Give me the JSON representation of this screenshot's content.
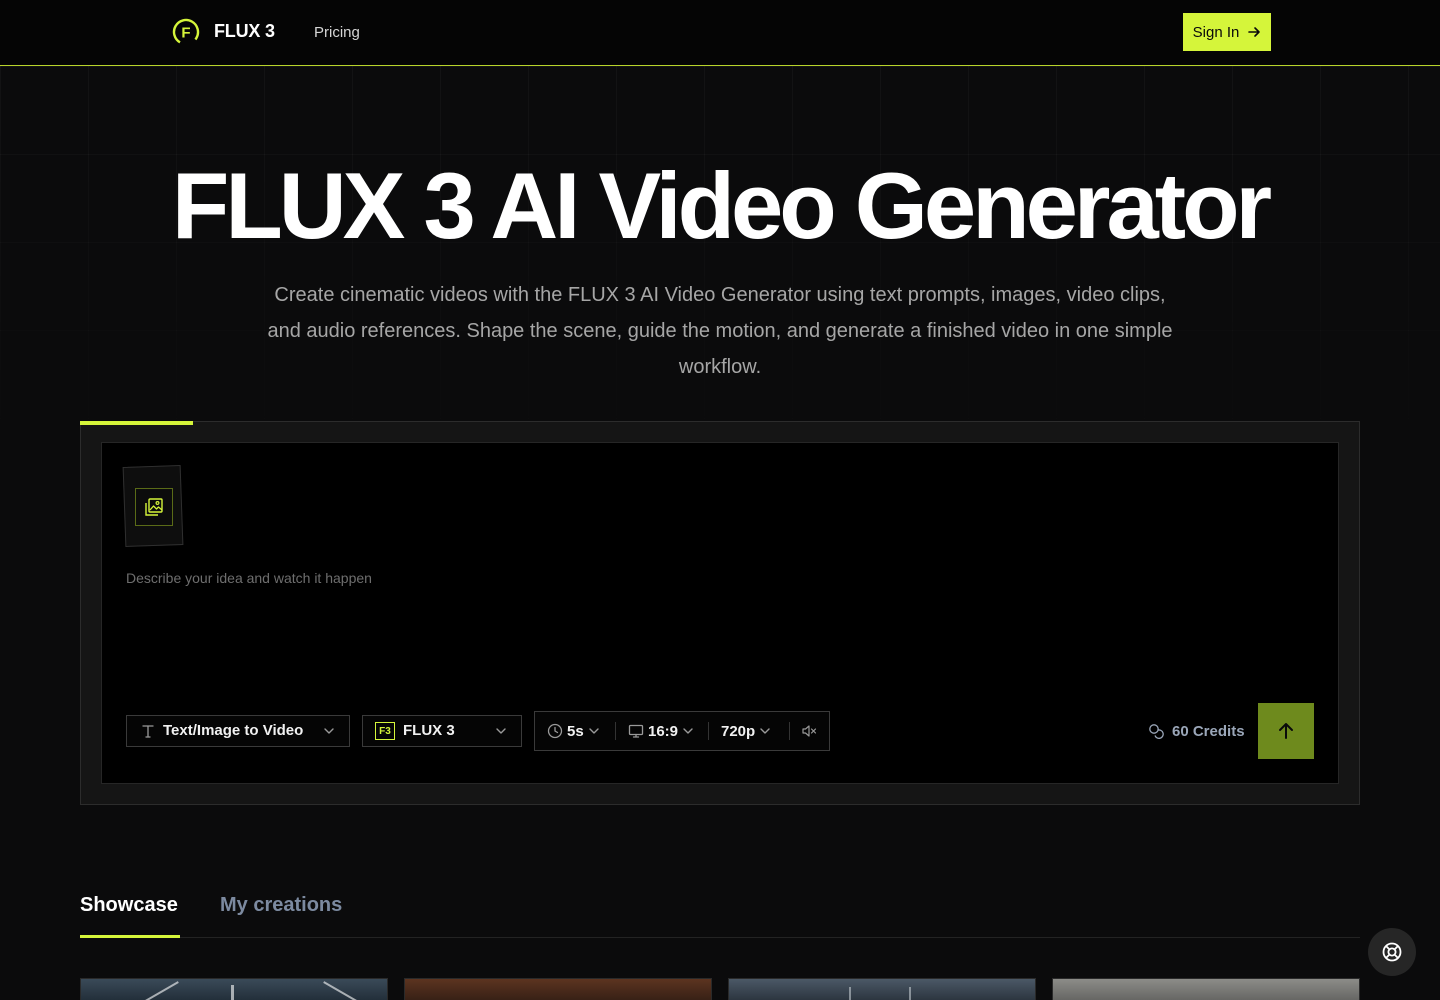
{
  "header": {
    "brand": "FLUX 3",
    "logo_letter": "F",
    "nav": [
      {
        "label": "Pricing"
      }
    ],
    "signin_label": "Sign In"
  },
  "hero": {
    "title": "FLUX 3 AI Video Generator",
    "subtitle": "Create cinematic videos with the FLUX 3 AI Video Generator using text prompts, images, video clips, and audio references. Shape the scene, guide the motion, and generate a finished video in one simple workflow."
  },
  "composer": {
    "prompt_placeholder": "Describe your idea and watch it happen",
    "mode": {
      "label": "Text/Image to Video",
      "icon": "text-icon"
    },
    "model": {
      "label": "FLUX 3",
      "badge": "F3"
    },
    "duration": "5s",
    "aspect_ratio": "16:9",
    "resolution": "720p",
    "audio_icon": "mute-icon",
    "credits": "60 Credits",
    "submit_icon": "arrow-up-icon"
  },
  "tabs": [
    {
      "label": "Showcase",
      "active": true
    },
    {
      "label": "My creations",
      "active": false
    }
  ],
  "colors": {
    "accent": "#d5f53a",
    "submit_bg": "#6e8a1d",
    "background": "#0b0b0c",
    "muted_text": "#a6a6a6",
    "inactive_tab": "#7c8aa0"
  }
}
